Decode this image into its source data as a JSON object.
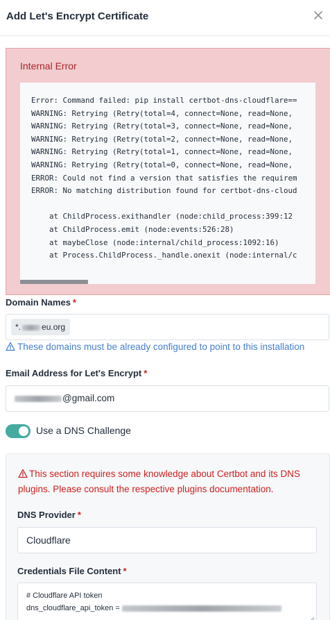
{
  "modal": {
    "title": "Add Let's Encrypt Certificate",
    "close_icon": "close-icon"
  },
  "error": {
    "title": "Internal Error",
    "lines": [
      "Error: Command failed: pip install certbot-dns-cloudflare==",
      "WARNING: Retrying (Retry(total=4, connect=None, read=None,",
      "WARNING: Retrying (Retry(total=3, connect=None, read=None,",
      "WARNING: Retrying (Retry(total=2, connect=None, read=None,",
      "WARNING: Retrying (Retry(total=1, connect=None, read=None,",
      "WARNING: Retrying (Retry(total=0, connect=None, read=None,",
      "ERROR: Could not find a version that satisfies the requirem",
      "ERROR: No matching distribution found for certbot-dns-cloud",
      "",
      "    at ChildProcess.exithandler (node:child_process:399:12",
      "    at ChildProcess.emit (node:events:526:28)",
      "    at maybeClose (node:internal/child_process:1092:16)",
      "    at Process.ChildProcess._handle.onexit (node:internal/c"
    ],
    "background_color": "#f2cccf",
    "text_color": "#a7262c"
  },
  "domain_names": {
    "label": "Domain Names",
    "required_mark": "*",
    "tag_prefix": "*.",
    "tag_suffix": "eu.org",
    "hint": "These domains must be already configured to point to this installation",
    "hint_icon": "warning-triangle-icon",
    "hint_color": "#467fcf"
  },
  "email": {
    "label": "Email Address for Let's Encrypt",
    "required_mark": "*",
    "value_suffix": "@gmail.com"
  },
  "dns_challenge": {
    "label": "Use a DNS Challenge",
    "enabled": true,
    "toggle_color": "#45aaa0"
  },
  "dns_section": {
    "warning": "This section requires some knowledge about Certbot and its DNS plugins. Please consult the respective plugins documentation.",
    "warning_icon": "warning-triangle-icon",
    "warning_color": "#cd201f",
    "provider_label": "DNS Provider",
    "provider_required_mark": "*",
    "provider_value": "Cloudflare",
    "credentials_label": "Credentials File Content",
    "credentials_required_mark": "*",
    "credentials_line1": "# Cloudflare API token",
    "credentials_line2_prefix": "dns_cloudflare_api_token = "
  }
}
